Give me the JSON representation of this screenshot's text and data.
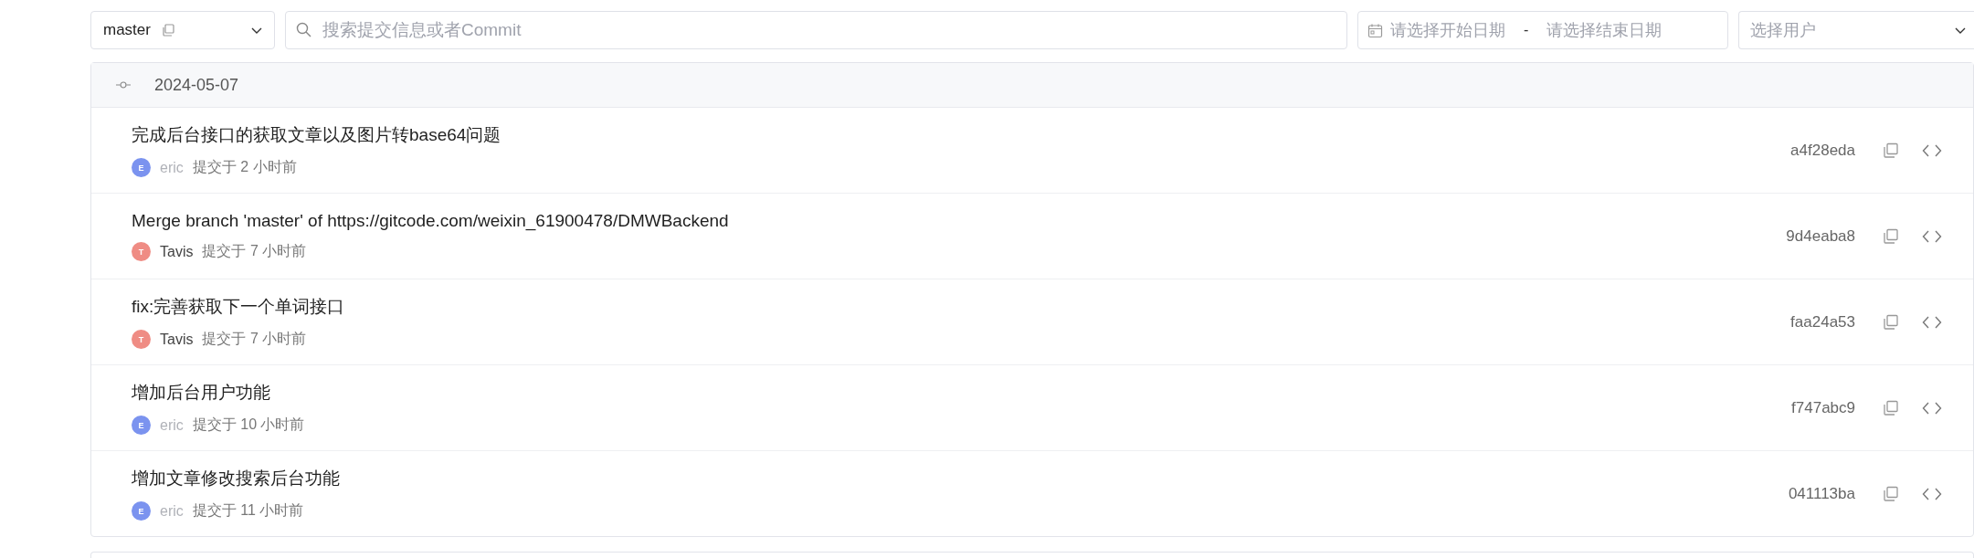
{
  "toolbar": {
    "branch": {
      "value": "master"
    },
    "search": {
      "placeholder": "搜索提交信息或者Commit"
    },
    "date_range": {
      "start_placeholder": "请选择开始日期",
      "separator": "-",
      "end_placeholder": "请选择结束日期"
    },
    "user_select": {
      "placeholder": "选择用户"
    }
  },
  "groups": [
    {
      "date": "2024-05-07",
      "commits": [
        {
          "message": "完成后台接口的获取文章以及图片转base64问题",
          "author": "eric",
          "initial": "E",
          "color": "#7b93ef",
          "author_muted": true,
          "time": "提交于 2 小时前",
          "hash": "a4f28eda"
        },
        {
          "message": "Merge branch 'master' of https://gitcode.com/weixin_61900478/DMWBackend",
          "author": "Tavis",
          "initial": "T",
          "color": "#ef8c84",
          "author_muted": false,
          "time": "提交于 7 小时前",
          "hash": "9d4eaba8"
        },
        {
          "message": "fix:完善获取下一个单词接口",
          "author": "Tavis",
          "initial": "T",
          "color": "#ef8c84",
          "author_muted": false,
          "time": "提交于 7 小时前",
          "hash": "faa24a53"
        },
        {
          "message": "增加后台用户功能",
          "author": "eric",
          "initial": "E",
          "color": "#7b93ef",
          "author_muted": true,
          "time": "提交于 10 小时前",
          "hash": "f747abc9"
        },
        {
          "message": "增加文章修改搜索后台功能",
          "author": "eric",
          "initial": "E",
          "color": "#7b93ef",
          "author_muted": true,
          "time": "提交于 11 小时前",
          "hash": "041113ba"
        }
      ]
    }
  ]
}
